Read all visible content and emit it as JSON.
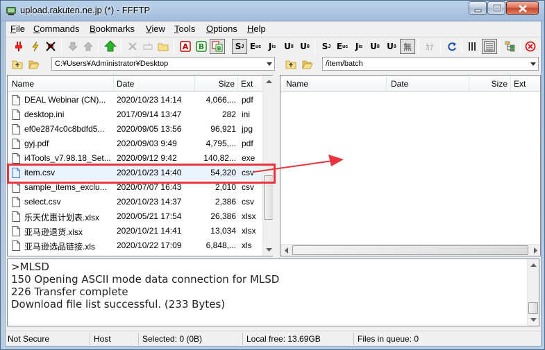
{
  "window": {
    "title": "upload.rakuten.ne.jp (*) - FFFTP",
    "app_icon": "ffftp-app-icon",
    "buttons": [
      "minimize-icon",
      "maximize-icon",
      "close-icon"
    ]
  },
  "menu": [
    {
      "label": "File",
      "accel": "F"
    },
    {
      "label": "Commands",
      "accel": "C"
    },
    {
      "label": "Bookmarks",
      "accel": "B"
    },
    {
      "label": "View",
      "accel": "V"
    },
    {
      "label": "Tools",
      "accel": "T"
    },
    {
      "label": "Options",
      "accel": "O"
    },
    {
      "label": "Help",
      "accel": "H"
    }
  ],
  "toolbar": {
    "pressed": [
      "auto-sjis-mode",
      "no-kana-convert",
      "list-view-detail"
    ],
    "kana_label": "ｶﾅ",
    "sjis_label": "S",
    "euc_label": "E",
    "jis_label": "J",
    "utf8_label": "U"
  },
  "local": {
    "path": "C:¥Users¥Administrator¥Desktop",
    "columns": [
      "Name",
      "Date",
      "Size",
      "Ext"
    ],
    "files": [
      {
        "name": "DEAL Webinar (CN)...",
        "date": "2020/10/23 14:14",
        "size": "4,066,...",
        "ext": "pdf"
      },
      {
        "name": "desktop.ini",
        "date": "2017/09/14 13:47",
        "size": "282",
        "ext": "ini"
      },
      {
        "name": "ef0e2874c0c8bdfd5...",
        "date": "2020/09/05 13:56",
        "size": "96,921",
        "ext": "jpg"
      },
      {
        "name": "gyj.pdf",
        "date": "2020/09/03  9:49",
        "size": "4,795,...",
        "ext": "pdf"
      },
      {
        "name": "i4Tools_v7.98.18_Set...",
        "date": "2020/09/12  9:42",
        "size": "140,82...",
        "ext": "exe"
      },
      {
        "name": "item.csv",
        "date": "2020/10/23 14:40",
        "size": "54,320",
        "ext": "csv"
      },
      {
        "name": "sample_items_exclu...",
        "date": "2020/07/07 16:43",
        "size": "2,010",
        "ext": "csv"
      },
      {
        "name": "select.csv",
        "date": "2020/10/23 14:37",
        "size": "2,386",
        "ext": "csv"
      },
      {
        "name": "乐天优惠计划表.xlsx",
        "date": "2020/05/21 17:54",
        "size": "26,386",
        "ext": "xlsx"
      },
      {
        "name": "亚马逊退货.xlsx",
        "date": "2020/10/21 14:41",
        "size": "13,034",
        "ext": "xlsx"
      },
      {
        "name": "亚马逊选品链接.xls",
        "date": "2020/10/22 17:09",
        "size": "6,848,...",
        "ext": "xls"
      }
    ],
    "selected_index": 5
  },
  "remote": {
    "path": "/item/batch",
    "columns": [
      "Name",
      "Date",
      "Size",
      "Ext"
    ]
  },
  "log": [
    ">MLSD",
    "150 Opening ASCII mode data connection for MLSD",
    "226 Transfer complete",
    "Download file list successful. (233 Bytes)"
  ],
  "status": {
    "security": "Not Secure",
    "host": "Host",
    "selected": "Selected: 0 (0B)",
    "local_free": "Local free: 13.69GB",
    "queue": "Files in queue: 0"
  },
  "colors": {
    "annotation": "#e8343c",
    "selection": "#eaf2fb"
  }
}
